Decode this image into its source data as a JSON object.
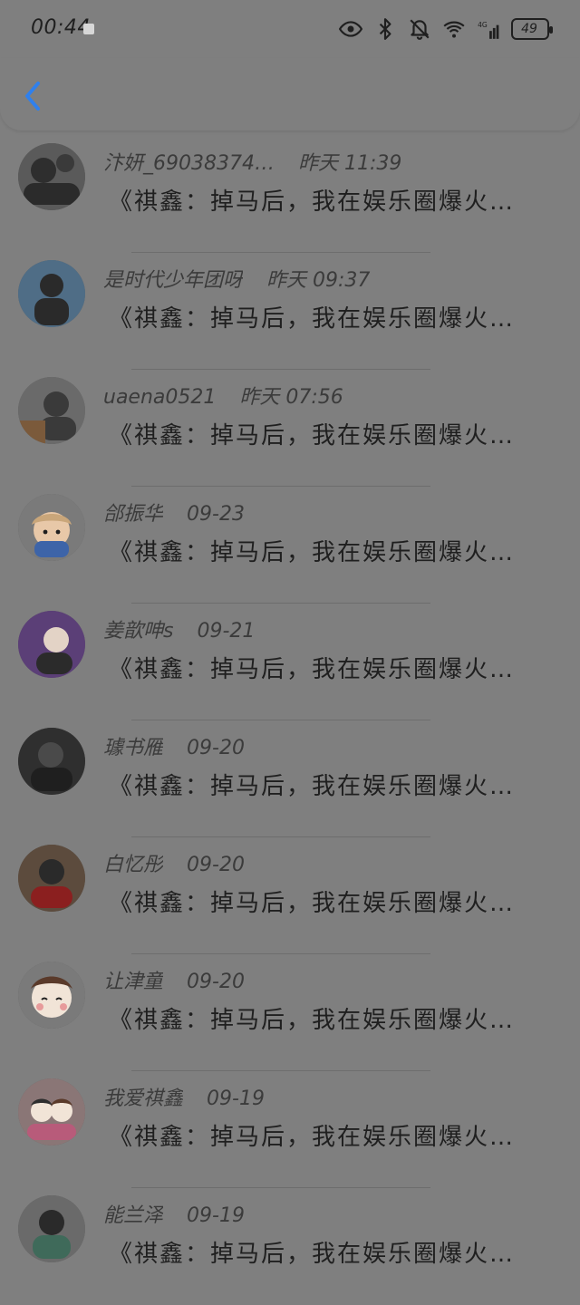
{
  "status_bar": {
    "time": "00:44",
    "battery": "49",
    "icons": [
      "eye-icon",
      "bluetooth-icon",
      "mute-bell-icon",
      "wifi-icon",
      "4g-signal-icon"
    ]
  },
  "header": {
    "back_icon": "chevron-left-icon",
    "accent_color": "#2f80ed"
  },
  "list": {
    "items": [
      {
        "user": "汴妍_69038374…",
        "time": "昨天 11:39",
        "message": "《祺鑫：掉马后，我在娱乐圈爆火…",
        "avatar_icon": "avatar-photo"
      },
      {
        "user": "是时代少年团呀",
        "time": "昨天 09:37",
        "message": "《祺鑫：掉马后，我在娱乐圈爆火…",
        "avatar_icon": "avatar-photo"
      },
      {
        "user": "uaena0521",
        "time": "昨天 07:56",
        "message": "《祺鑫：掉马后，我在娱乐圈爆火…",
        "avatar_icon": "avatar-photo"
      },
      {
        "user": "郃振华",
        "time": "09-23",
        "message": "《祺鑫：掉马后，我在娱乐圈爆火…",
        "avatar_icon": "avatar-cartoon"
      },
      {
        "user": "姜歆呻s",
        "time": "09-21",
        "message": "《祺鑫：掉马后，我在娱乐圈爆火…",
        "avatar_icon": "avatar-photo"
      },
      {
        "user": "璩书雁",
        "time": "09-20",
        "message": "《祺鑫：掉马后，我在娱乐圈爆火…",
        "avatar_icon": "avatar-photo"
      },
      {
        "user": "白忆彤",
        "time": "09-20",
        "message": "《祺鑫：掉马后，我在娱乐圈爆火…",
        "avatar_icon": "avatar-photo"
      },
      {
        "user": "让津童",
        "time": "09-20",
        "message": "《祺鑫：掉马后，我在娱乐圈爆火…",
        "avatar_icon": "avatar-cartoon"
      },
      {
        "user": "我爱祺鑫",
        "time": "09-19",
        "message": "《祺鑫：掉马后，我在娱乐圈爆火…",
        "avatar_icon": "avatar-cartoon"
      },
      {
        "user": "能兰泽",
        "time": "09-19",
        "message": "《祺鑫：掉马后，我在娱乐圈爆火…",
        "avatar_icon": "avatar-photo"
      }
    ]
  }
}
